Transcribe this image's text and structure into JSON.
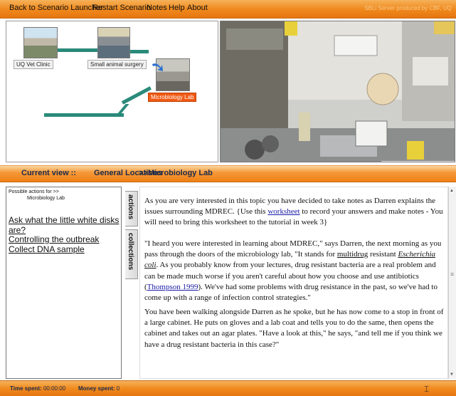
{
  "menu": {
    "back": "Back to Scenario Launcher",
    "restart": "Restart Scenario",
    "notes": "Notes",
    "help": "Help",
    "about": "About",
    "credit": "SBLi Server produced by CBF, UQ"
  },
  "map": {
    "nodes": [
      {
        "label": "UQ Vet Clinic"
      },
      {
        "label": "Small animal surgery"
      },
      {
        "label": "Microbiology Lab"
      }
    ],
    "accent": "#2a8a7a",
    "current_color": "#f05a14"
  },
  "view": {
    "prefix": "Current view ::",
    "location": "General Locations",
    "current": ">>Microbiology Lab"
  },
  "actions": {
    "header_line1": "Possible actions for >>",
    "header_line2": "Microbiology Lab",
    "items": [
      "Ask what the little white disks are?",
      "Controlling the outbreak",
      "Collect DNA sample"
    ],
    "tabs": [
      "actions",
      "collections"
    ]
  },
  "story": {
    "p1": [
      "As you are very interested in this topic you have decided to take notes as Darren explains the issues surrounding MDREC. {Use this ",
      "worksheet",
      " to record your answers and make notes - You will need to bring this worksheet to the tutorial in week 3}"
    ],
    "p2": [
      "\"I heard you were interested in learning about MDREC,\" says Darren, the next morning as you pass through the doors of the microbiology lab, \"It stands for ",
      "multidrug",
      " resistant ",
      "Escherichia coli",
      ". As you probably know from your lectures, drug resistant bacteria are a real problem and can be made much worse if you aren't careful about how you choose and use antibiotics (",
      "Thompson 1999",
      "). We've had some problems with drug resistance in the past, so we've had to come up with a range of infection control strategies.\""
    ],
    "p3": "You have been walking alongside Darren as he spoke, but he has now come to a stop in front of a large cabinet.  He puts on gloves and a lab coat and tells you to do the same, then opens the cabinet and takes out an agar plates.  \"Have a look at this,\" he says, \"and tell me if you think we have a  drug resistant bacteria in this case?\""
  },
  "status": {
    "time_label": "Time spent:",
    "time_value": "00:00:00",
    "money_label": "Money spent:",
    "money_value": "0"
  }
}
